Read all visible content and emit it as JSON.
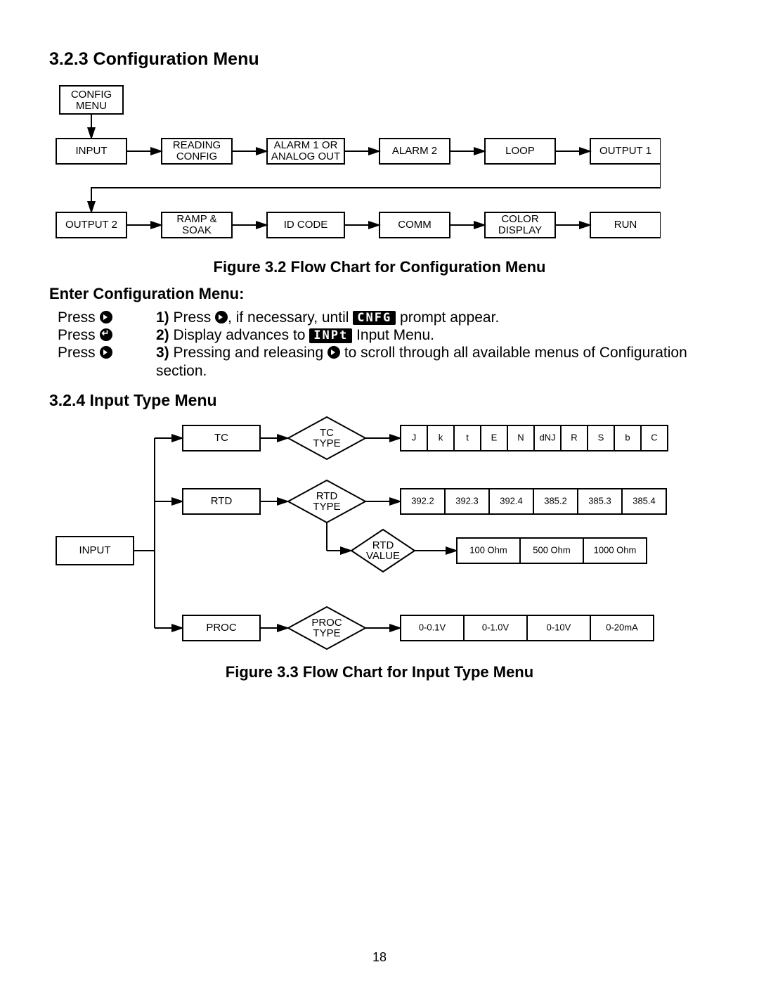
{
  "page_number": "18",
  "section323": {
    "heading": "3.2.3 Configuration Menu",
    "fig_caption": "Figure 3.2 Flow Chart for Configuration Menu",
    "boxes": {
      "config": "CONFIG MENU",
      "input": "INPUT",
      "reading": "READING CONFIG",
      "alarm1": "ALARM 1 OR ANALOG OUT",
      "alarm2": "ALARM 2",
      "loop": "LOOP",
      "output1": "OUTPUT 1",
      "output2": "OUTPUT 2",
      "ramp": "RAMP & SOAK",
      "idcode": "ID CODE",
      "comm": "COMM",
      "color": "COLOR DISPLAY",
      "run": "RUN"
    }
  },
  "enter_menu": {
    "heading": "Enter Configuration Menu:",
    "press1": "Press ",
    "press2": "Press ",
    "press3": "Press ",
    "step1a": "1)",
    "step1b_pre": " Press ",
    "step1b_mid": ", if necessary, until ",
    "badge1": "CNFG",
    "step1b_post": " prompt appear.",
    "step2a": "2)",
    "step2b_pre": " Display advances to ",
    "badge2": "INPt",
    "step2b_post": " Input Menu.",
    "step3a": "3)",
    "step3b_pre": " Pressing and releasing ",
    "step3b_post": " to scroll through all available menus of Configuration section."
  },
  "section324": {
    "heading": "3.2.4  Input Type Menu",
    "fig_caption": "Figure 3.3 Flow Chart for Input Type Menu",
    "input": "INPUT",
    "tc": "TC",
    "tctype": "TC TYPE",
    "rtd": "RTD",
    "rtdtype": "RTD TYPE",
    "rtdvalue": "RTD VALUE",
    "proc": "PROC",
    "proctype": "PROC TYPE",
    "tc_opts": [
      "J",
      "k",
      "t",
      "E",
      "N",
      "dNJ",
      "R",
      "S",
      "b",
      "C"
    ],
    "rtd_opts": [
      "392.2",
      "392.3",
      "392.4",
      "385.2",
      "385.3",
      "385.4"
    ],
    "rtdv_opts": [
      "100 Ohm",
      "500 Ohm",
      "1000 Ohm"
    ],
    "proc_opts": [
      "0-0.1V",
      "0-1.0V",
      "0-10V",
      "0-20mA"
    ]
  }
}
